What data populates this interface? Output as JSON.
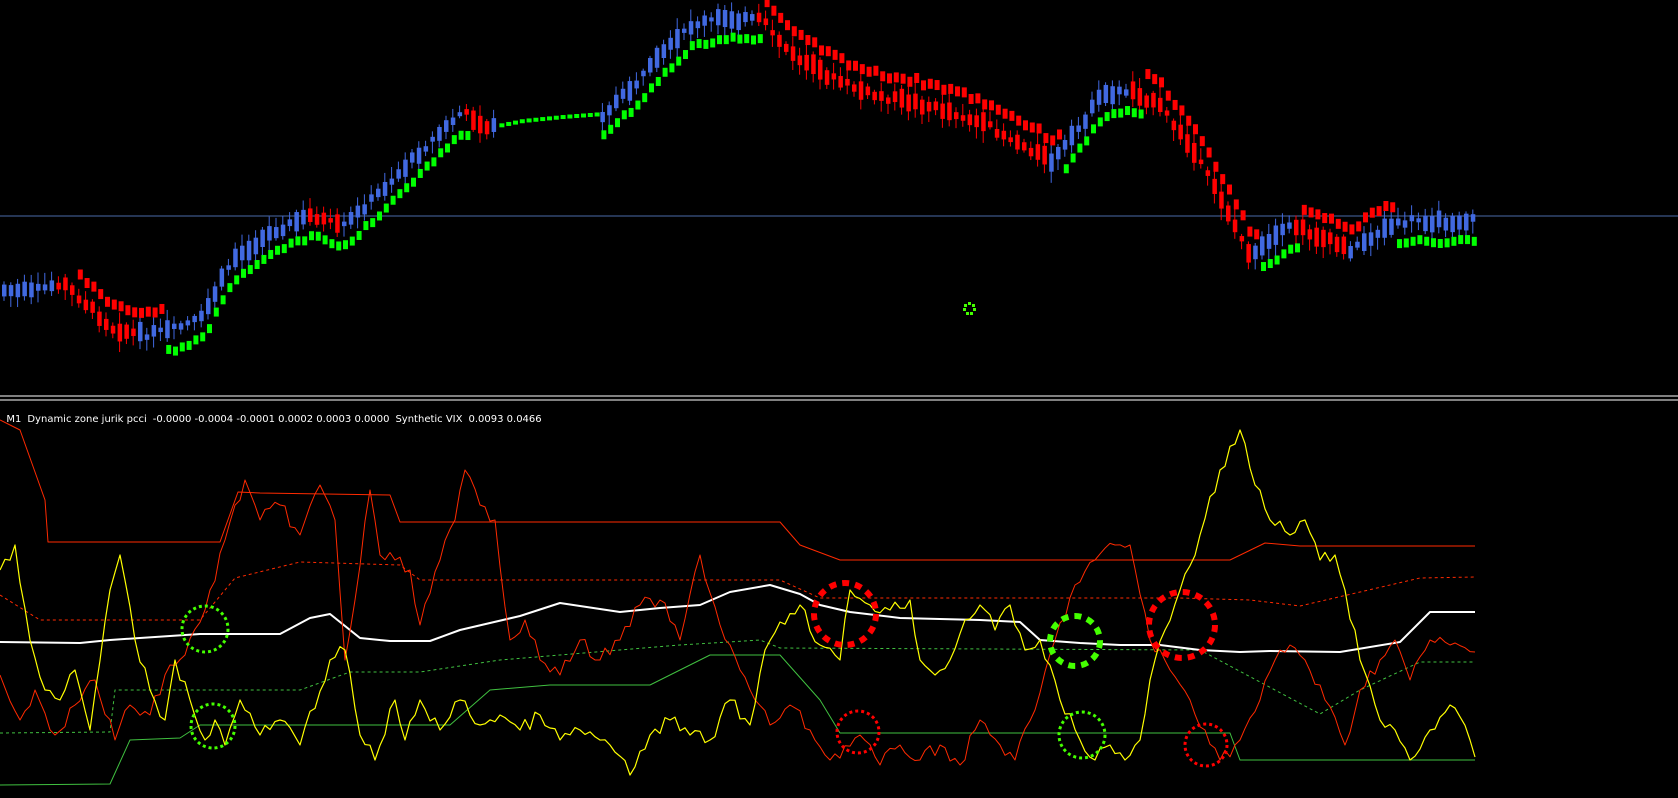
{
  "indicator_header": {
    "timeframe": "M1",
    "indicator1_name": "Dynamic zone jurik pcci",
    "indicator1_values": "-0.0000 -0.0004 -0.0001 0.0002 0.0003 0.0000",
    "indicator2_name": "Synthetic VIX",
    "indicator2_values": "0.0093 0.0466"
  },
  "colors": {
    "background": "#000000",
    "bull_candle": "#4169e1",
    "bear_candle": "#ff0000",
    "trail_up": "#00ff00",
    "trail_down": "#ff0000",
    "price_line": "#4a6aa8",
    "separator": "#ffffff",
    "vix_line": "#ffff00",
    "pcci_line": "#ff2a00",
    "zone_upper": "#ff2a00",
    "zone_lower": "#40c040",
    "jurik_mid": "#ffffff",
    "marker_bull": "#44ff00",
    "marker_bear": "#ff0000"
  },
  "chart_data": {
    "type": "line",
    "note": "",
    "markers": [
      {
        "type": "bull-circle",
        "style": "dotted"
      },
      {
        "type": "bull-circle",
        "style": "dotted"
      },
      {
        "type": "bear-circle",
        "style": "dashed"
      },
      {
        "type": "bear-circle",
        "style": "dotted"
      },
      {
        "type": "bull-circle",
        "style": "dashed"
      },
      {
        "type": "bull-circle",
        "style": "dotted"
      },
      {
        "type": "bear-circle",
        "style": "dashed"
      },
      {
        "type": "bear-circle",
        "style": "dotted"
      }
    ]
  }
}
